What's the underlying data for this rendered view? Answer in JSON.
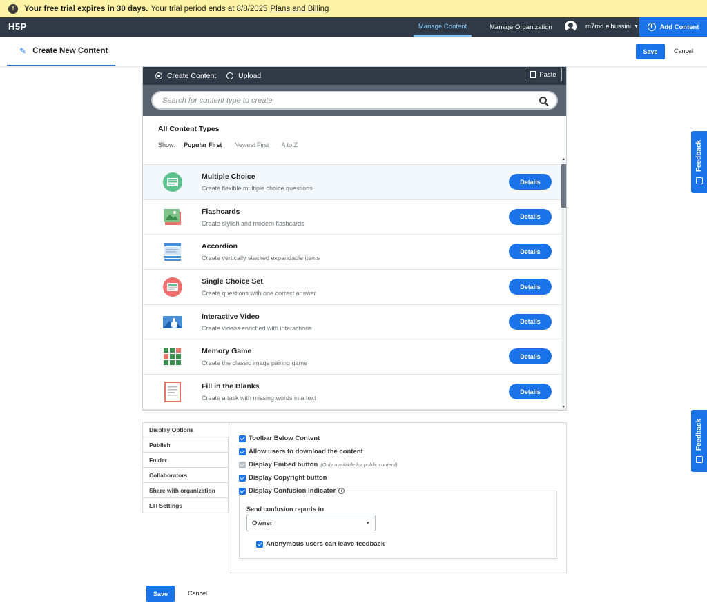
{
  "trial": {
    "strong": "Your free trial expires in 30 days.",
    "text": "Your trial period ends at 8/8/2025",
    "link": "Plans and Billing"
  },
  "nav": {
    "logo": "H5P",
    "manage_content": "Manage Content",
    "manage_org": "Manage Organization",
    "user": "m7md elhussini",
    "add_content": "Add Content"
  },
  "titlebar": {
    "title": "Create New Content",
    "save": "Save",
    "cancel": "Cancel"
  },
  "hub": {
    "create_label": "Create Content",
    "upload_label": "Upload",
    "paste": "Paste",
    "search_placeholder": "Search for content type to create",
    "heading": "All Content Types",
    "show_label": "Show:",
    "sort_popular": "Popular First",
    "sort_newest": "Newest First",
    "sort_az": "A to Z",
    "details_label": "Details",
    "items": [
      {
        "title": "Multiple Choice",
        "desc": "Create flexible multiple choice questions"
      },
      {
        "title": "Flashcards",
        "desc": "Create stylish and modern flashcards"
      },
      {
        "title": "Accordion",
        "desc": "Create vertically stacked expandable items"
      },
      {
        "title": "Single Choice Set",
        "desc": "Create questions with one correct answer"
      },
      {
        "title": "Interactive Video",
        "desc": "Create videos enriched with interactions"
      },
      {
        "title": "Memory Game",
        "desc": "Create the classic image pairing game"
      },
      {
        "title": "Fill in the Blanks",
        "desc": "Create a task with missing words in a text"
      }
    ]
  },
  "feedback": "Feedback",
  "options": {
    "tabs": [
      "Display Options",
      "Publish",
      "Folder",
      "Collaborators",
      "Share with organization",
      "LTI Settings"
    ],
    "toolbar": "Toolbar Below Content",
    "download": "Allow users to download the content",
    "embed": "Display Embed button",
    "embed_note": "(Only available for public content)",
    "copyright": "Display Copyright button",
    "confusion": "Display Confusion Indicator",
    "send_label": "Send confusion reports to:",
    "send_value": "Owner",
    "anonymous": "Anonymous users can leave feedback"
  },
  "footer": {
    "save": "Save",
    "cancel": "Cancel"
  },
  "colors": {
    "accent": "#1a73e8",
    "nav_bg": "#2f3a46",
    "banner": "#fcf3a6"
  }
}
